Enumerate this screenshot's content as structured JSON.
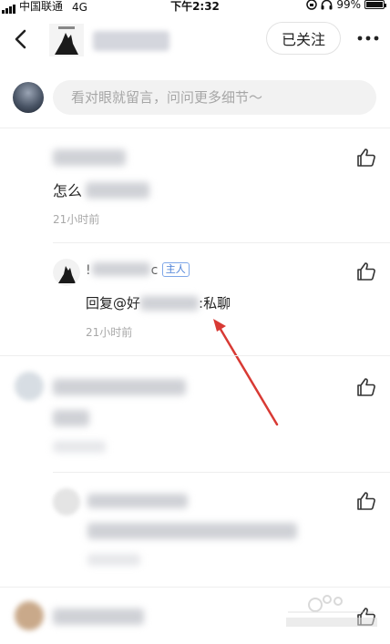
{
  "status_bar": {
    "carrier": "中国联通",
    "network": "4G",
    "time": "下午2:32",
    "battery": "99%",
    "battery_level": 0.99
  },
  "header": {
    "back_icon": "chevron-left-icon",
    "follow_label": "已关注",
    "more_icon": "more-dots-icon"
  },
  "comment_box": {
    "placeholder": "看对眼就留言，问问更多细节～"
  },
  "comments": [
    {
      "text_prefix": "怎么",
      "time": "21小时前",
      "like_icon": "thumbs-up-icon"
    }
  ],
  "reply": {
    "name_prefix": "!",
    "name_suffix": "c",
    "host_badge": "主人",
    "text_prefix": "回复@好",
    "text_suffix": ":私聊",
    "time": "21小时前",
    "like_icon": "thumbs-up-icon"
  },
  "colors": {
    "annotation_arrow": "#d83a34",
    "host_badge": "#4a7fd6",
    "timestamp": "#a8a8a8"
  }
}
